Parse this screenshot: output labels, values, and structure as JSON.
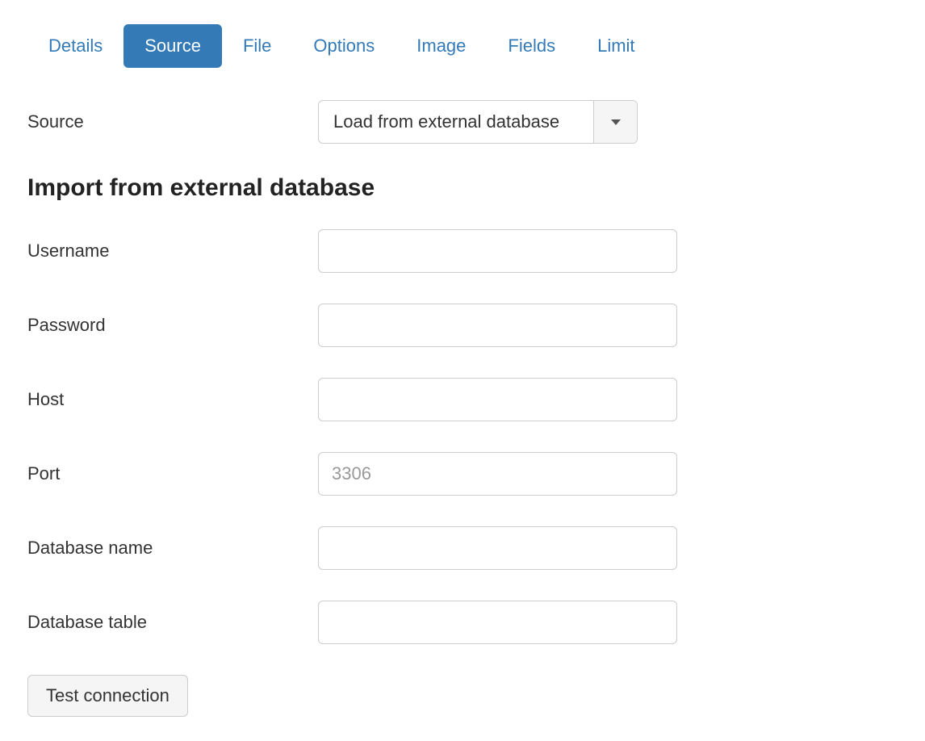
{
  "tabs": {
    "details": "Details",
    "source": "Source",
    "file": "File",
    "options": "Options",
    "image": "Image",
    "fields": "Fields",
    "limit": "Limit",
    "active": "source"
  },
  "source_row": {
    "label": "Source",
    "selected": "Load from external database"
  },
  "section_heading": "Import from external database",
  "fields": {
    "username": {
      "label": "Username",
      "value": ""
    },
    "password": {
      "label": "Password",
      "value": ""
    },
    "host": {
      "label": "Host",
      "value": ""
    },
    "port": {
      "label": "Port",
      "value": "",
      "placeholder": "3306"
    },
    "database_name": {
      "label": "Database name",
      "value": ""
    },
    "database_table": {
      "label": "Database table",
      "value": ""
    }
  },
  "buttons": {
    "test_connection": "Test connection"
  }
}
